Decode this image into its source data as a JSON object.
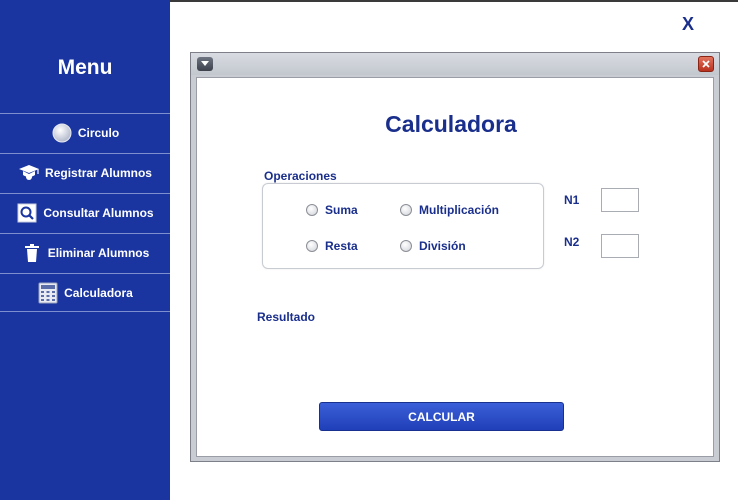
{
  "window": {
    "close_label": "X"
  },
  "sidebar": {
    "title": "Menu",
    "items": [
      {
        "label": "Circulo",
        "icon": "circle-icon"
      },
      {
        "label": "Registrar Alumnos",
        "icon": "graduation-cap-icon"
      },
      {
        "label": "Consultar Alumnos",
        "icon": "magnifier-icon"
      },
      {
        "label": "Eliminar Alumnos",
        "icon": "trash-icon"
      },
      {
        "label": "Calculadora",
        "icon": "calculator-icon"
      }
    ]
  },
  "calculator": {
    "title": "Calculadora",
    "operations_label": "Operaciones",
    "operations": [
      "Suma",
      "Multiplicación",
      "Resta",
      "División"
    ],
    "n1_label": "N1",
    "n1_value": "",
    "n2_label": "N2",
    "n2_value": "",
    "result_label": "Resultado",
    "calculate_button": "CALCULAR"
  },
  "colors": {
    "sidebar_bg": "#1a35a0",
    "accent_text": "#1a2f8c",
    "button_bg": "#2a4ac8"
  }
}
